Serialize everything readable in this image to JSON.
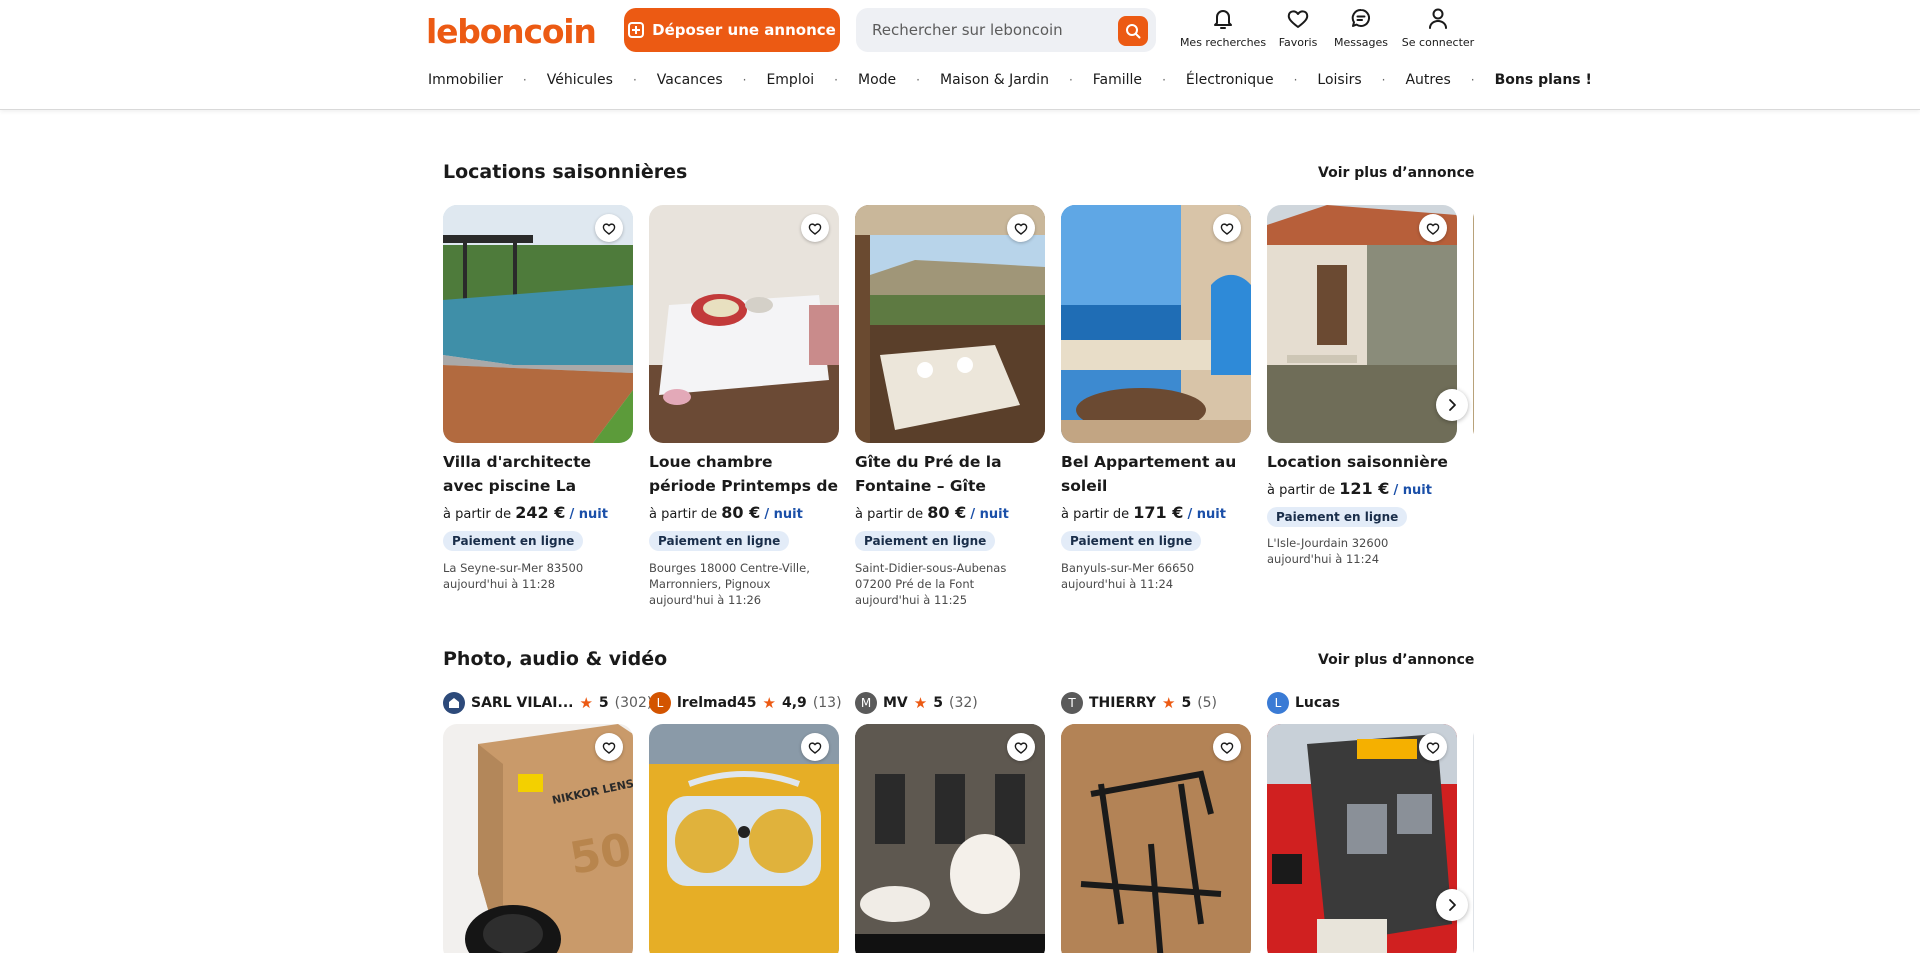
{
  "header": {
    "logo": "leboncoin",
    "post_button": "Déposer une annonce",
    "search_placeholder": "Rechercher sur leboncoin",
    "icons": [
      {
        "label": "Mes recherches",
        "icon": "bell-icon"
      },
      {
        "label": "Favoris",
        "icon": "heart-icon"
      },
      {
        "label": "Messages",
        "icon": "chat-icon"
      },
      {
        "label": "Se connecter",
        "icon": "user-icon"
      }
    ]
  },
  "nav": [
    "Immobilier",
    "Véhicules",
    "Vacances",
    "Emploi",
    "Mode",
    "Maison & Jardin",
    "Famille",
    "Électronique",
    "Loisirs",
    "Autres",
    "Bons plans !"
  ],
  "colors": {
    "brand": "#ec5a13",
    "badge_bg": "#e3ecf8",
    "text": "#1a1a1a"
  },
  "section1": {
    "title": "Locations saisonnières",
    "see_more": "Voir plus d’annonces",
    "cards": [
      {
        "title": "Villa d'architecte avec piscine La Seyne sur Mer",
        "prefix": "à partir de",
        "price": "242 €",
        "unit": "/ nuit",
        "badge": "Paiement en ligne",
        "location": "La Seyne-sur-Mer 83500",
        "date": "aujourd'hui à 11:28"
      },
      {
        "title": "Loue chambre période Printemps de Bourges",
        "prefix": "à partir de",
        "price": "80 €",
        "unit": "/ nuit",
        "badge": "Paiement en ligne",
        "location": "Bourges 18000 Centre-Ville, Marronniers, Pignoux",
        "date": "aujourd'hui à 11:26"
      },
      {
        "title": "Gîte du Pré de la Fontaine – Gîte nature ...",
        "prefix": "à partir de",
        "price": "80 €",
        "unit": "/ nuit",
        "badge": "Paiement en ligne",
        "location": "Saint-Didier-sous-Aubenas 07200 Pré de la Font",
        "date": "aujourd'hui à 11:25"
      },
      {
        "title": "Bel Appartement au soleil",
        "prefix": "à partir de",
        "price": "171 €",
        "unit": "/ nuit",
        "badge": "Paiement en ligne",
        "location": "Banyuls-sur-Mer 66650",
        "date": "aujourd'hui à 11:24"
      },
      {
        "title": "Location saisonnière",
        "prefix": "à partir de",
        "price": "121 €",
        "unit": "/ nuit",
        "badge": "Paiement en ligne",
        "location": "L'Isle-Jourdain 32600",
        "date": "aujourd'hui à 11:24"
      }
    ]
  },
  "section2": {
    "title": "Photo, audio & vidéo",
    "see_more": "Voir plus d’annonces",
    "sellers": [
      {
        "initial": "",
        "name": "SARL VILAI...",
        "rating": "5",
        "count": "(302)",
        "color": "#2d4a7a"
      },
      {
        "initial": "L",
        "name": "lrelmad45",
        "rating": "4,9",
        "count": "(13)",
        "color": "#d35400"
      },
      {
        "initial": "M",
        "name": "MV",
        "rating": "5",
        "count": "(32)",
        "color": "#5a5a5a"
      },
      {
        "initial": "T",
        "name": "THIERRY",
        "rating": "5",
        "count": "(5)",
        "color": "#5a5a5a"
      },
      {
        "initial": "L",
        "name": "Lucas",
        "rating": "",
        "count": "",
        "color": "#3a7bd5"
      }
    ]
  }
}
